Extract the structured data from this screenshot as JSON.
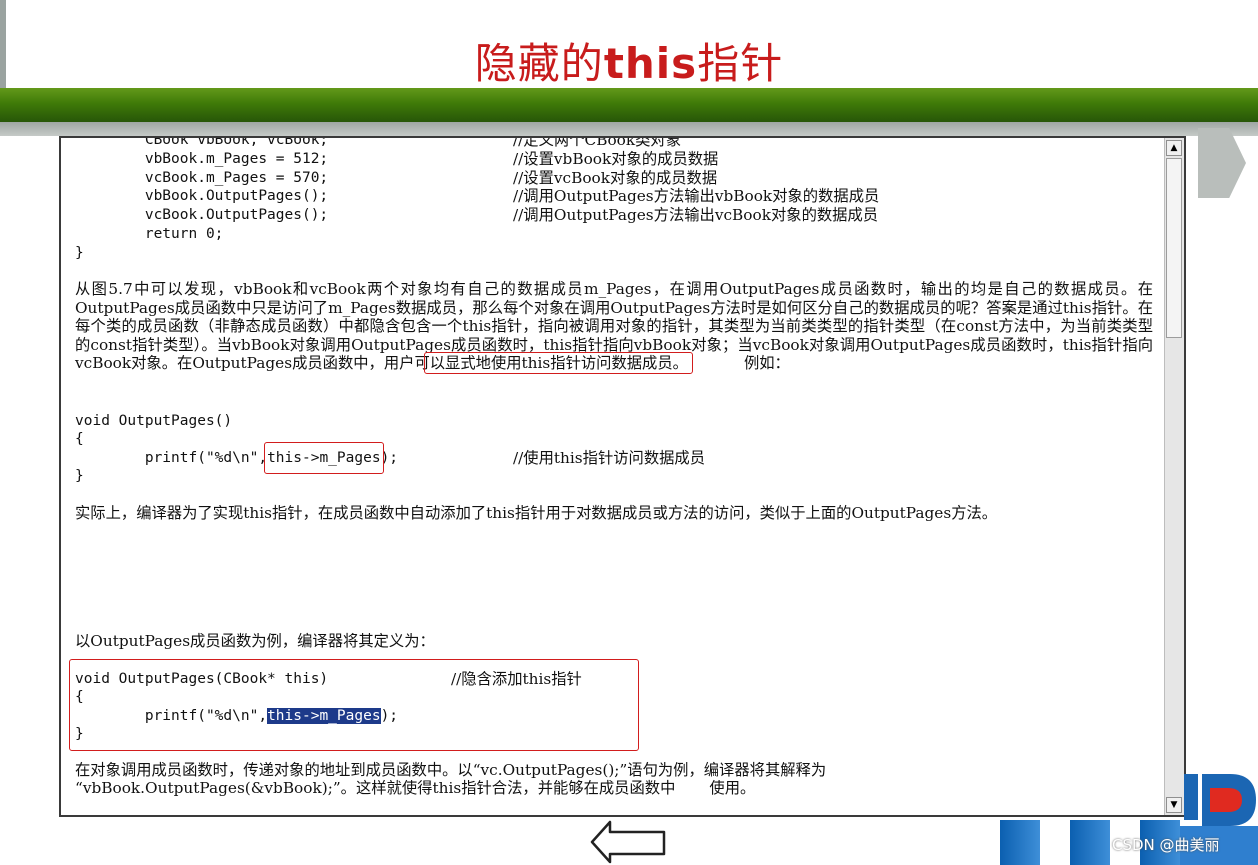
{
  "slide": {
    "title_cn_left": "隐藏的",
    "title_bold": "this",
    "title_cn_right": "指针"
  },
  "doc": {
    "code1": [
      {
        "code": "        CBook vbBook, vcBook;",
        "comment": "//定义两个CBook类对象"
      },
      {
        "code": "        vbBook.m_Pages = 512;",
        "comment": "//设置vbBook对象的成员数据"
      },
      {
        "code": "        vcBook.m_Pages = 570;",
        "comment": "//设置vcBook对象的成员数据"
      },
      {
        "code": "        vbBook.OutputPages();",
        "comment": "//调用OutputPages方法输出vbBook对象的数据成员"
      },
      {
        "code": "        vcBook.OutputPages();",
        "comment": "//调用OutputPages方法输出vcBook对象的数据成员"
      },
      {
        "code": "        return 0;",
        "comment": ""
      },
      {
        "code": "}",
        "comment": ""
      }
    ],
    "para1": "从图5.7中可以发现，vbBook和vcBook两个对象均有自己的数据成员m_Pages，在调用OutputPages成员函数时，输出的均是自己的数据成员。在OutputPages成员函数中只是访问了m_Pages数据成员，那么每个对象在调用OutputPages方法时是如何区分自己的数据成员的呢？答案是通过this指针。在每个类的成员函数（非静态成员函数）中都隐含包含一个this指针，指向被调用对象的指针，其类型为当前类类型的指针类型（在const方法中，为当前类类型的const指针类型）。当vbBook对象调用OutputPages成员函数时，this指针指向vbBook对象；当vcBook对象调用OutputPages成员函数时，this指针指向vcBook对象。在OutputPages成员函数中，用户可",
    "para1_box": "以显式地使用this指针访问数据成员。",
    "para1_tail": "例如：",
    "code2_sig": "void OutputPages()",
    "code2_open": "{",
    "code2_printf": "        printf(\"%d\\n\",",
    "code2_this": "this->m_Pages",
    "code2_end": ");",
    "code2_comment": "//使用this指针访问数据成员",
    "code2_close": "}",
    "para2": "实际上，编译器为了实现this指针，在成员函数中自动添加了this指针用于对数据成员或方法的访问，类似于上面的OutputPages方法。",
    "para3": "以OutputPages成员函数为例，编译器将其定义为：",
    "code3_sig": "void OutputPages(CBook* this)",
    "code3_comment": "//隐含添加this指针",
    "code3_open": "{",
    "code3_printf": "        printf(\"%d\\n\",",
    "code3_sel": "this->m_Pages",
    "code3_end": ");",
    "code3_close": "}",
    "para4_line1": "在对象调用成员函数时，传递对象的地址到成员函数中。以“vc.OutputPages();”语句为例，编译器将其解释为",
    "para4_line2": "“vbBook.OutputPages(&vbBook);”。这样就使得this指针合法，并能够在成员函数中       使用。"
  },
  "scrollbar": {
    "up": "▲",
    "down": "▼"
  },
  "watermark": "CSDN @曲美丽",
  "colors": {
    "title": "#c81c1c",
    "band": "#3f7a08",
    "highlight": "#d21d1d",
    "selection": "#1d3a8a"
  }
}
